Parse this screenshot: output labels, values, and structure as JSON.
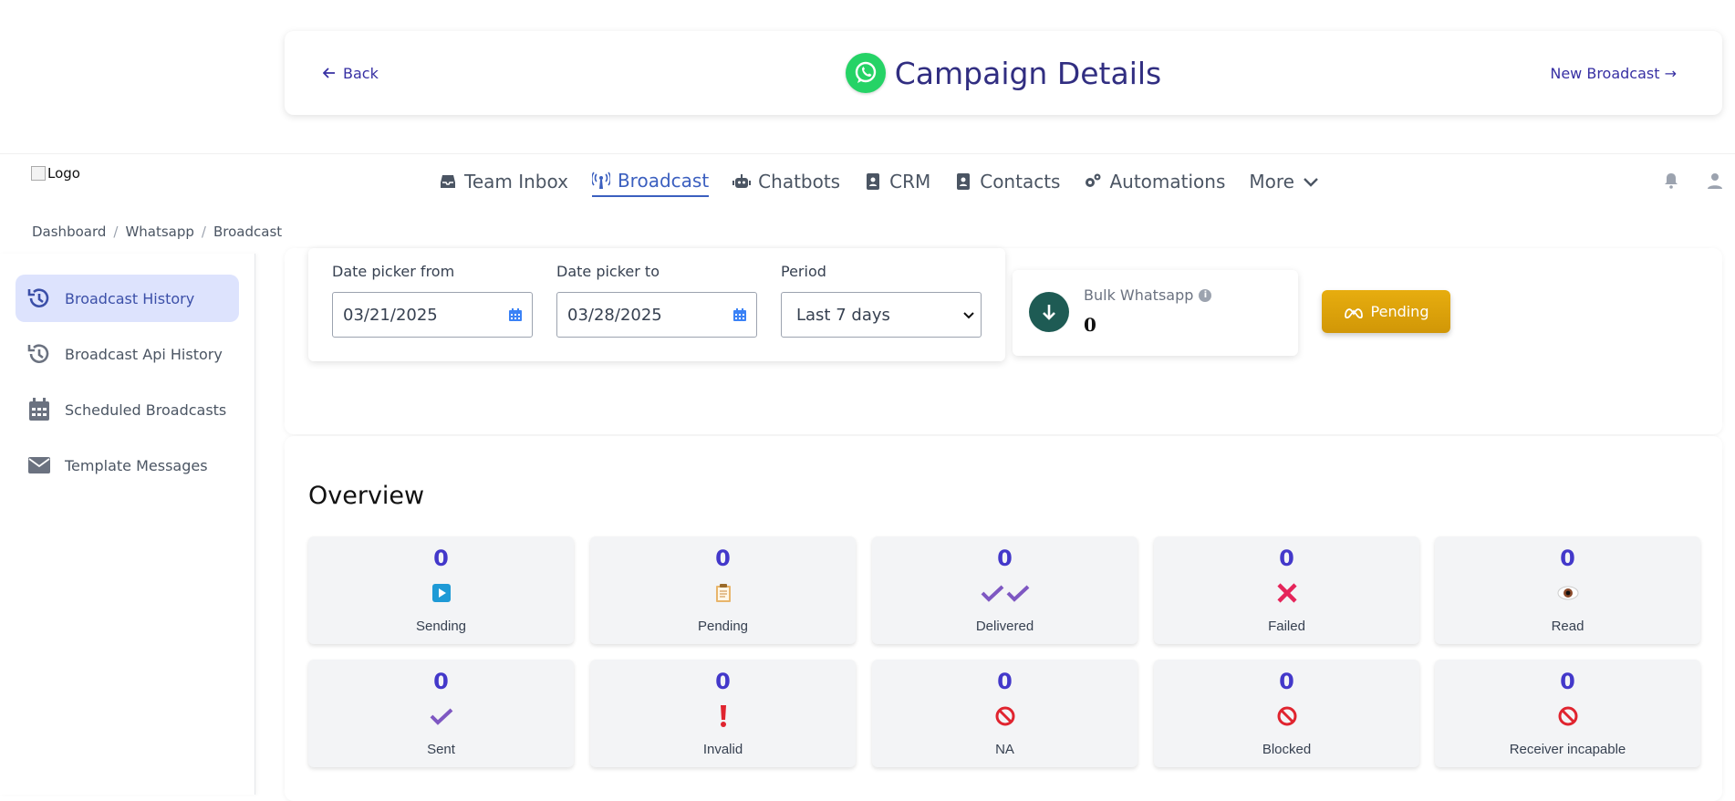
{
  "header": {
    "back_label": "Back",
    "title": "Campaign Details",
    "new_broadcast_label": "New Broadcast →"
  },
  "nav": {
    "logo_alt": "Logo",
    "items": [
      {
        "label": "Team Inbox",
        "icon": "inbox-icon"
      },
      {
        "label": "Broadcast",
        "icon": "broadcast-tower-icon",
        "active": true
      },
      {
        "label": "Chatbots",
        "icon": "robot-icon"
      },
      {
        "label": "CRM",
        "icon": "address-book-icon"
      },
      {
        "label": "Contacts",
        "icon": "contact-book-icon"
      },
      {
        "label": "Automations",
        "icon": "gears-icon"
      },
      {
        "label": "More",
        "icon": "chevron-down-icon"
      }
    ]
  },
  "breadcrumb": [
    "Dashboard",
    "Whatsapp",
    "Broadcast"
  ],
  "sidebar": {
    "items": [
      {
        "label": "Broadcast History",
        "icon": "history-icon",
        "active": true
      },
      {
        "label": "Broadcast Api History",
        "icon": "history-icon"
      },
      {
        "label": "Scheduled Broadcasts",
        "icon": "calendar-icon"
      },
      {
        "label": "Template Messages",
        "icon": "envelope-icon"
      }
    ]
  },
  "filters": {
    "date_from_label": "Date picker from",
    "date_from_value": "03/21/2025",
    "date_to_label": "Date picker to",
    "date_to_value": "03/28/2025",
    "period_label": "Period",
    "period_value": "Last 7 days"
  },
  "bulk": {
    "title": "Bulk Whatsapp",
    "count": "0"
  },
  "pending_button": "Pending",
  "overview": {
    "title": "Overview",
    "stats": [
      {
        "value": "0",
        "label": "Sending",
        "icon": "play-icon"
      },
      {
        "value": "0",
        "label": "Pending",
        "icon": "clipboard-icon"
      },
      {
        "value": "0",
        "label": "Delivered",
        "icon": "double-check-icon"
      },
      {
        "value": "0",
        "label": "Failed",
        "icon": "cross-icon"
      },
      {
        "value": "0",
        "label": "Read",
        "icon": "eye-icon"
      },
      {
        "value": "0",
        "label": "Sent",
        "icon": "check-icon"
      },
      {
        "value": "0",
        "label": "Invalid",
        "icon": "exclamation-icon"
      },
      {
        "value": "0",
        "label": "NA",
        "icon": "prohibited-icon"
      },
      {
        "value": "0",
        "label": "Blocked",
        "icon": "prohibited-icon"
      },
      {
        "value": "0",
        "label": "Receiver incapable",
        "icon": "prohibited-icon"
      }
    ]
  },
  "colors": {
    "primary": "#3730a3",
    "accent": "#4338ca",
    "sidebar_active_bg": "#dde3fd",
    "pending_gold": "#e0a40c",
    "bulk_green": "#1e5b54"
  }
}
